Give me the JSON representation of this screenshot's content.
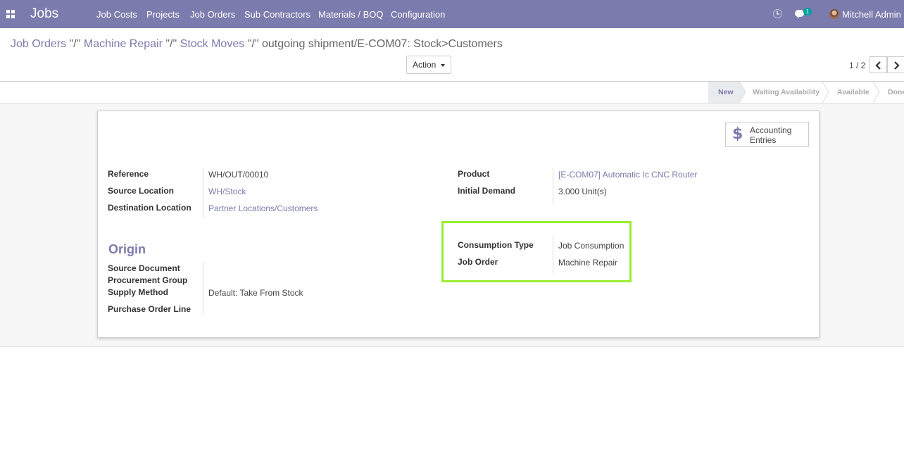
{
  "app": {
    "title": "Jobs",
    "menu": [
      "Job Costs",
      "Projects",
      "Job Orders",
      "Sub Contractors",
      "Materials / BOQ",
      "Configuration"
    ],
    "chat_count": "1",
    "user_name": "Mitchell Admin",
    "navbar_color": "#7c7bad",
    "accent_color": "#7c7bad",
    "highlight_color": "#99ee33"
  },
  "breadcrumb": {
    "items": [
      "Job Orders",
      "Machine Repair",
      "Stock Moves"
    ],
    "separator": "\"/\"",
    "current": "outgoing shipment/E-COM07: Stock>Customers"
  },
  "toolbar": {
    "action_label": "Action"
  },
  "pager": {
    "value": "1 / 2"
  },
  "status": {
    "stages": [
      "New",
      "Waiting Availability",
      "Available",
      "Done"
    ],
    "active": "New"
  },
  "smart_button": {
    "label_line1": "Accounting",
    "label_line2": "Entries",
    "icon": "dollar-icon"
  },
  "form": {
    "left": {
      "reference_label": "Reference",
      "reference_value": "WH/OUT/00010",
      "source_location_label": "Source Location",
      "source_location_value": "WH/Stock",
      "destination_location_label": "Destination Location",
      "destination_location_value": "Partner Locations/Customers"
    },
    "right": {
      "product_label": "Product",
      "product_value": "[E-COM07] Automatic Ic CNC Router",
      "initial_demand_label": "Initial Demand",
      "initial_demand_qty": "3.000",
      "initial_demand_uom": "Unit(s)",
      "consumption_type_label": "Consumption Type",
      "consumption_type_value": "Job Consumption",
      "job_order_label": "Job Order",
      "job_order_value": "Machine Repair"
    },
    "origin": {
      "title": "Origin",
      "source_document_label": "Source Document",
      "procurement_group_label": "Procurement Group",
      "supply_method_label": "Supply Method",
      "supply_method_value": "Default: Take From Stock",
      "purchase_order_line_label": "Purchase Order Line"
    }
  }
}
